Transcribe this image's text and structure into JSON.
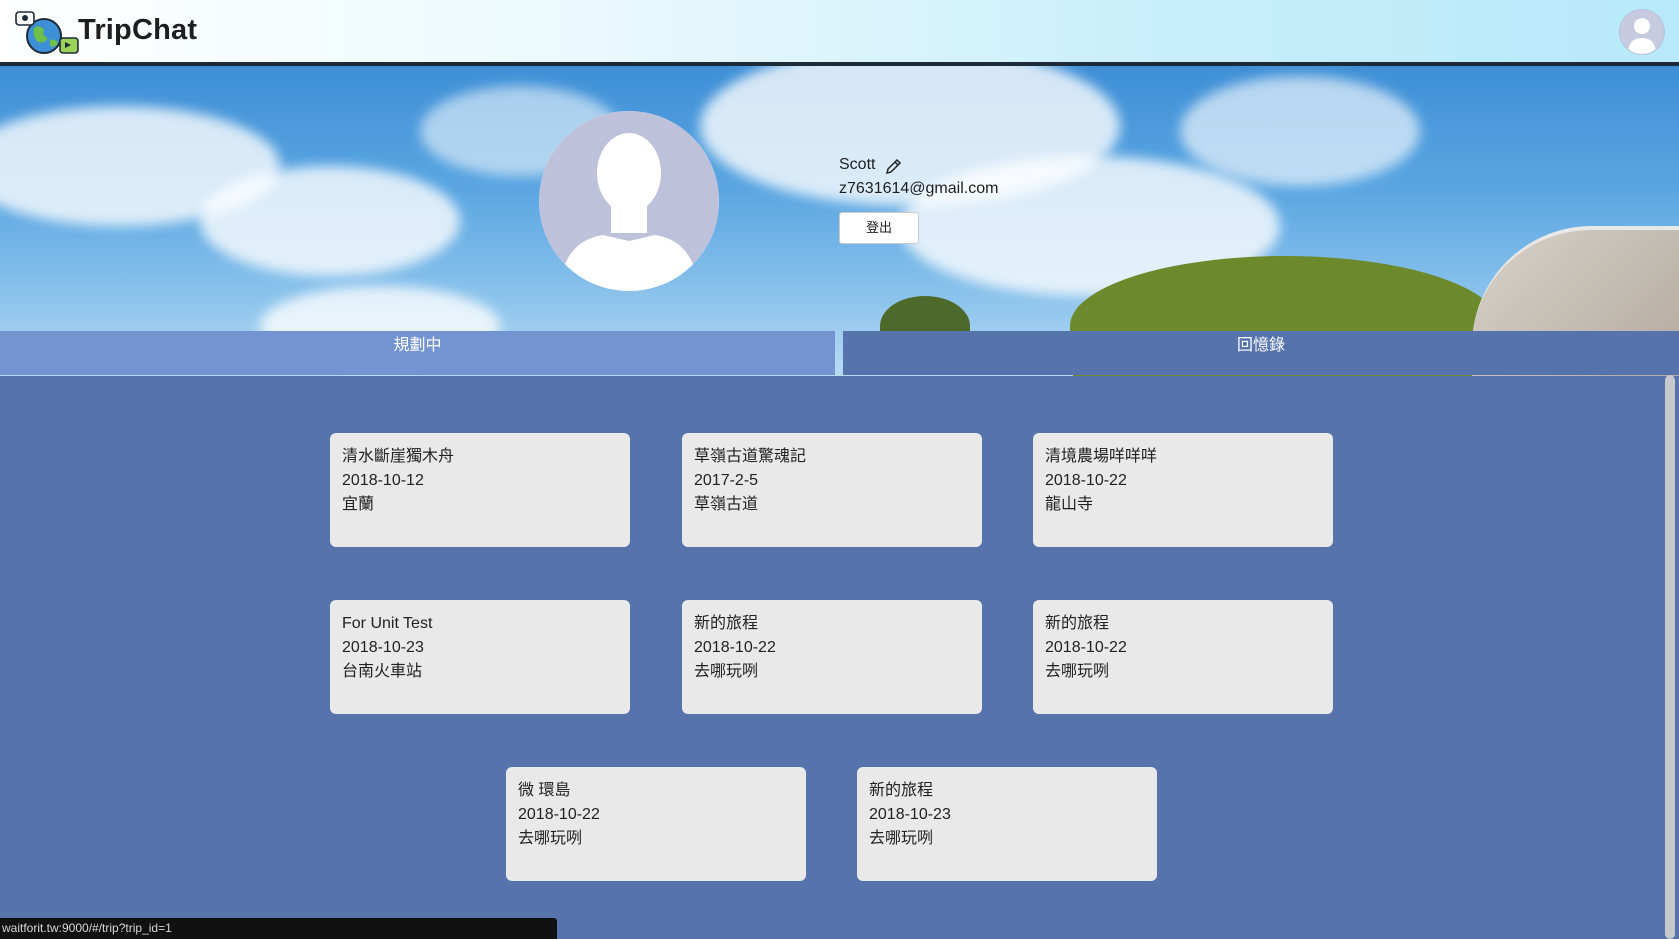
{
  "app": {
    "name": "TripChat",
    "logo_icon": "globe-chat-logo-icon",
    "header_avatar_icon": "user-avatar-icon"
  },
  "profile": {
    "name": "Scott",
    "email": "z7631614@gmail.com",
    "logout_label": "登出",
    "edit_icon": "pencil-icon",
    "photo_icon": "default-person-silhouette-icon"
  },
  "tabs": [
    {
      "label": "規劃中",
      "active": true
    },
    {
      "label": "回憶錄",
      "active": false
    }
  ],
  "trips": [
    {
      "title": "清水斷崖獨木舟",
      "date": "2018-10-12",
      "location": "宜蘭"
    },
    {
      "title": "草嶺古道驚魂記",
      "date": "2017-2-5",
      "location": "草嶺古道"
    },
    {
      "title": "清境農場咩咩咩",
      "date": "2018-10-22",
      "location": "龍山寺"
    },
    {
      "title": "For Unit Test",
      "date": "2018-10-23",
      "location": "台南火車站"
    },
    {
      "title": "新的旅程",
      "date": "2018-10-22",
      "location": "去哪玩咧"
    },
    {
      "title": "新的旅程",
      "date": "2018-10-22",
      "location": "去哪玩咧"
    },
    {
      "title": "微 環島",
      "date": "2018-10-22",
      "location": "去哪玩咧"
    },
    {
      "title": "新的旅程",
      "date": "2018-10-23",
      "location": "去哪玩咧"
    }
  ],
  "status_bar": {
    "url": "waitforit.tw:9000/#/trip?trip_id=1"
  },
  "colors": {
    "page_background": "#5773ab",
    "active_tab": "#7393d1",
    "card_background": "#e9e9ea"
  }
}
